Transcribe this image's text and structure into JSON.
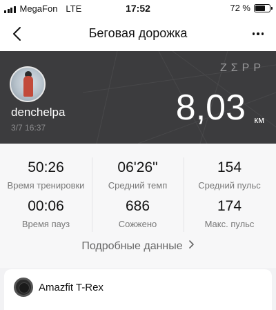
{
  "status_bar": {
    "carrier": "MegaFon",
    "network": "LTE",
    "time": "17:52",
    "battery_percent": "72 %",
    "battery_level": 0.72
  },
  "nav": {
    "title": "Беговая дорожка",
    "back_icon": "chevron-left-icon",
    "more_icon": "more-dots-icon"
  },
  "workout": {
    "brand": "ZΣPP",
    "username": "denchelpa",
    "datetime": "3/7 16:37",
    "distance": "8,03",
    "unit": "км"
  },
  "stats": [
    {
      "value": "50:26",
      "label": "Время тренировки"
    },
    {
      "value": "06'26\"",
      "label": "Средний темп"
    },
    {
      "value": "154",
      "label": "Средний пульс"
    },
    {
      "value": "00:06",
      "label": "Время пауз"
    },
    {
      "value": "686",
      "label": "Сожжено"
    },
    {
      "value": "174",
      "label": "Макс. пульс"
    }
  ],
  "details_link": "Подробные данные",
  "device": {
    "name": "Amazfit T-Rex",
    "icon": "watch-icon"
  },
  "colors": {
    "hero_bg": "#3c3c3e",
    "page_bg": "#f2f2f4"
  }
}
